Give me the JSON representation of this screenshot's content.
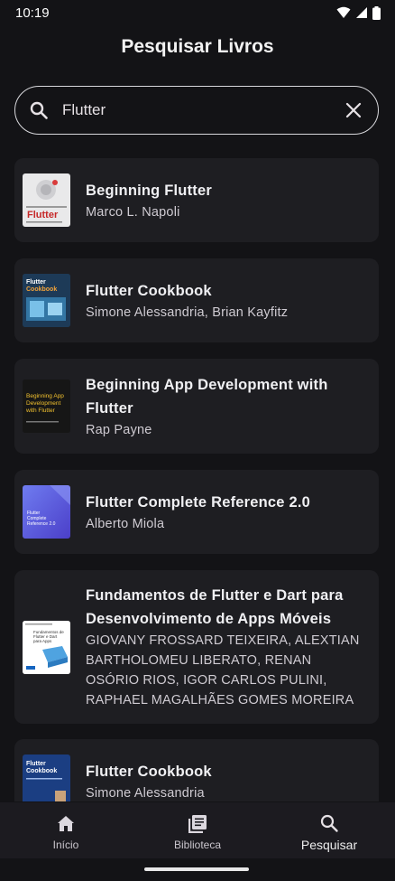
{
  "status_bar": {
    "time": "10:19"
  },
  "header": {
    "title": "Pesquisar Livros"
  },
  "search": {
    "value": "Flutter"
  },
  "results": [
    {
      "title": "Beginning Flutter",
      "authors": "Marco L. Napoli",
      "cover_text": "Flutter"
    },
    {
      "title": "Flutter Cookbook",
      "authors": "Simone Alessandria, Brian Kayfitz",
      "cover_text": "Flutter Cookbook"
    },
    {
      "title": "Beginning App Development with Flutter",
      "authors": "Rap Payne",
      "cover_text": "Beginning App Development with Flutter"
    },
    {
      "title": "Flutter Complete Reference 2.0",
      "authors": "Alberto Miola",
      "cover_text": "Flutter Complete Reference 2.0"
    },
    {
      "title": "Fundamentos de Flutter e Dart para Desenvolvimento de Apps Móveis",
      "authors": "GIOVANY FROSSARD TEIXEIRA, ALEXTIAN BARTHOLOMEU LIBERATO,   RENAN OSÓRIO RIOS,   IGOR CARLOS PULINI, RAPHAEL MAGALHÃES GOMES MOREIRA",
      "cover_text": "Fundamentos de Flutter e Dart para Desenvolvimento de Apps Móveis"
    },
    {
      "title": "Flutter Cookbook",
      "authors": "Simone Alessandria",
      "cover_text": "Flutter Cookbook"
    }
  ],
  "bottom_nav": {
    "items": [
      {
        "label": "Início",
        "icon": "home-icon"
      },
      {
        "label": "Biblioteca",
        "icon": "library-icon"
      },
      {
        "label": "Pesquisar",
        "icon": "search-icon",
        "active": true
      }
    ]
  },
  "colors": {
    "background": "#131316",
    "card": "#1E1E22",
    "nav": "#1C1B20"
  }
}
